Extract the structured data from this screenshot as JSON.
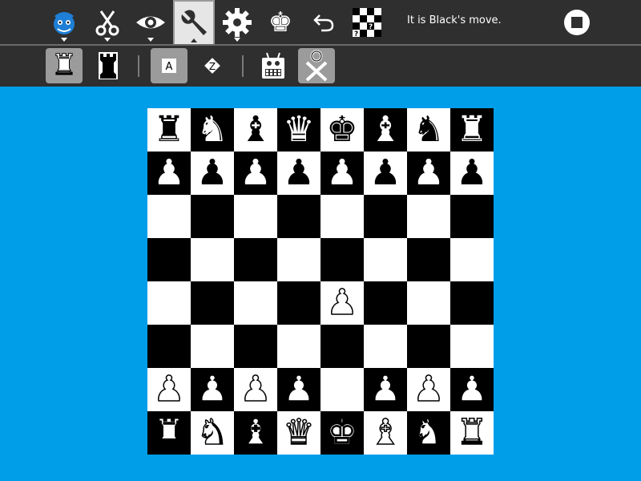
{
  "toolbar": {
    "status": "It is Black's move.",
    "buttons": [
      {
        "name": "activity-icon",
        "glyph": "♞"
      },
      {
        "name": "edit-cut-icon",
        "glyph": "✂"
      },
      {
        "name": "view-eye-icon",
        "glyph": "👁"
      },
      {
        "name": "tools-wrench-icon",
        "glyph": "🔧"
      },
      {
        "name": "settings-gear-icon",
        "glyph": "⚙"
      },
      {
        "name": "king-spark-icon",
        "glyph": "♚"
      },
      {
        "name": "undo-icon",
        "glyph": "↶"
      }
    ]
  },
  "secondary_toolbar": {
    "buttons": [
      {
        "name": "play-white-rook-icon",
        "glyph": "♖",
        "selected": true
      },
      {
        "name": "play-black-rook-icon",
        "glyph": "♜",
        "selected": false
      },
      {
        "name": "text-A-icon",
        "glyph": "A",
        "selected": true
      },
      {
        "name": "text-Z-icon",
        "glyph": "Z",
        "selected": false
      },
      {
        "name": "robot-icon",
        "glyph": "🤖",
        "selected": false
      },
      {
        "name": "xo-person-icon",
        "glyph": "✕",
        "selected": true
      }
    ]
  },
  "board": {
    "light_color": "#ffffff",
    "dark_color": "#000000",
    "rows": [
      [
        "r",
        "n",
        "b",
        "q",
        "k",
        "b",
        "n",
        "r"
      ],
      [
        "p",
        "p",
        "p",
        "p",
        "p",
        "p",
        "p",
        "p"
      ],
      [
        "",
        "",
        "",
        "",
        "",
        "",
        "",
        ""
      ],
      [
        "",
        "",
        "",
        "",
        "",
        "",
        "",
        ""
      ],
      [
        "",
        "",
        "",
        "",
        "P",
        "",
        "",
        ""
      ],
      [
        "",
        "",
        "",
        "",
        "",
        "",
        "",
        ""
      ],
      [
        "P",
        "P",
        "P",
        "P",
        "",
        "P",
        "P",
        "P"
      ],
      [
        "R",
        "N",
        "B",
        "Q",
        "K",
        "B",
        "N",
        "R"
      ]
    ]
  },
  "colors": {
    "background": "#009ee9",
    "toolbar": "#2f2f2f"
  }
}
